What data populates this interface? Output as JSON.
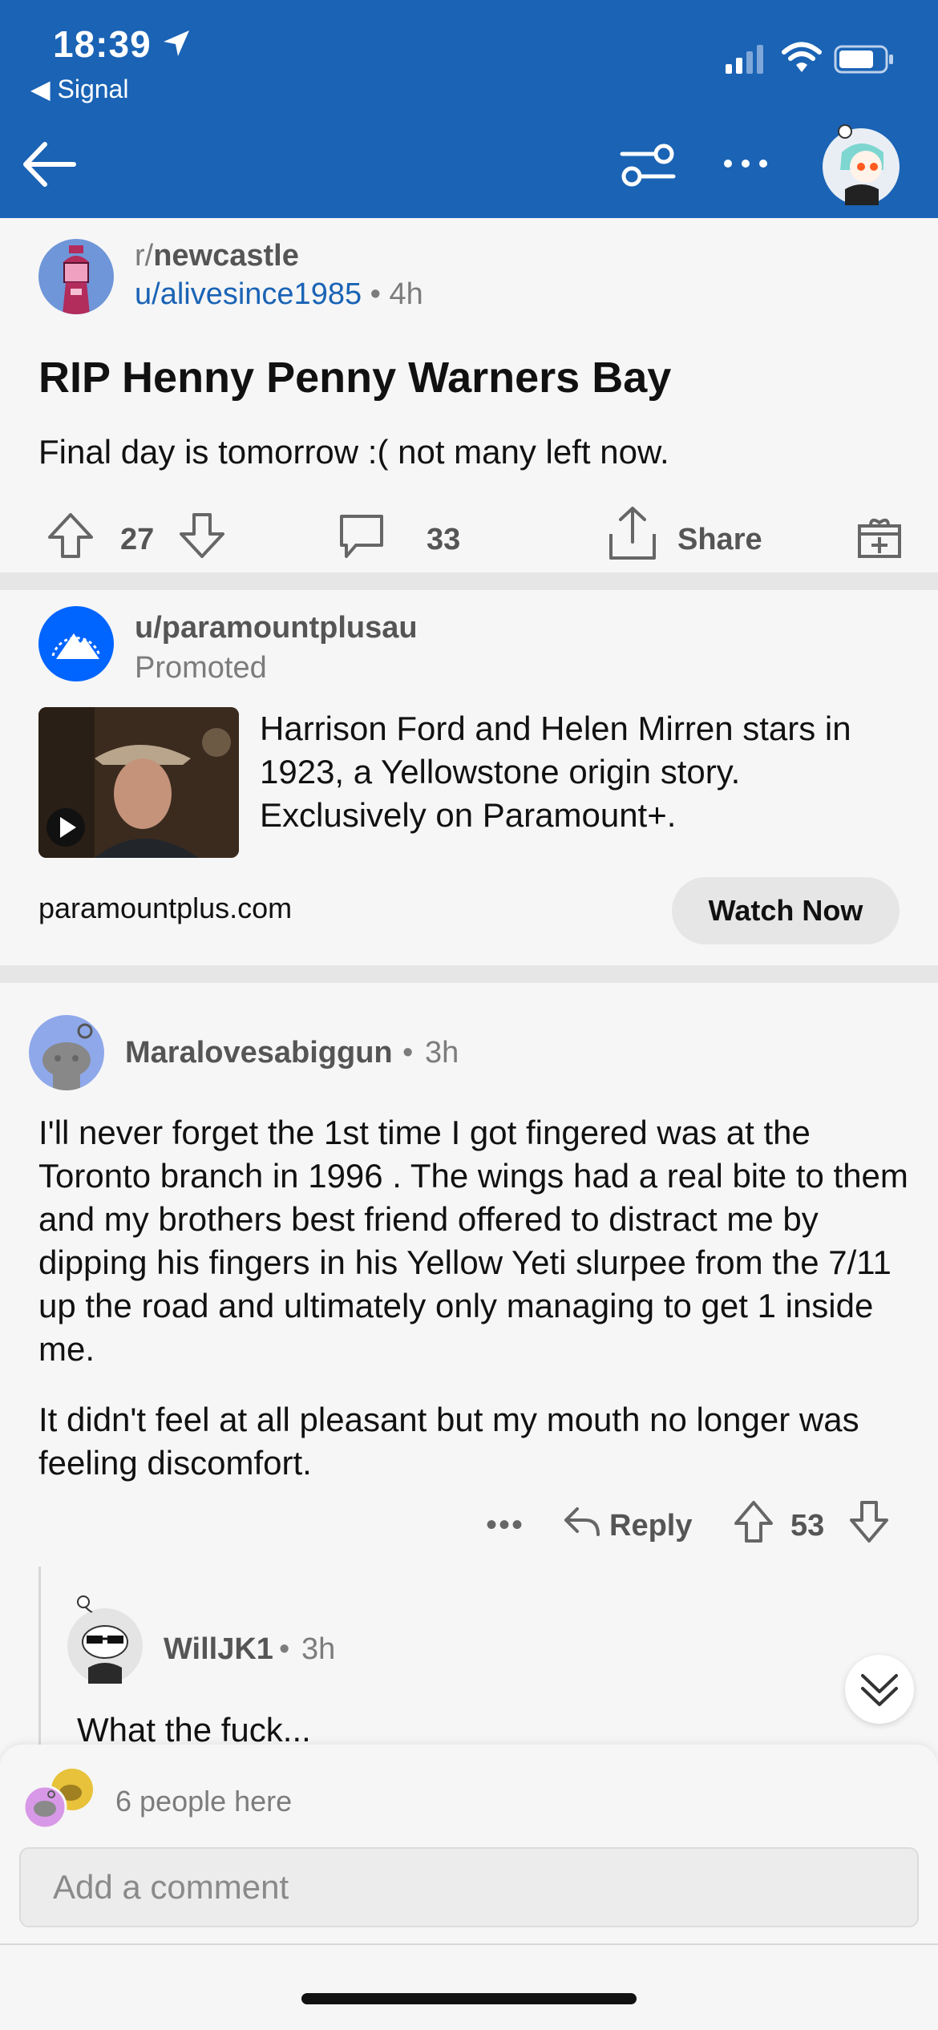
{
  "status_bar": {
    "time": "18:39",
    "back_app": "◀ Signal"
  },
  "colors": {
    "header_bg": "#1a63b5",
    "link_blue": "#1a63b5",
    "meta_gray": "#7c7c7c"
  },
  "icons": {
    "back": "back-arrow-icon",
    "filter": "sliders-icon",
    "more": "more-dots-icon",
    "profile": "avatar-icon",
    "upvote": "upvote-icon",
    "downvote": "downvote-icon",
    "comment": "comment-icon",
    "share": "share-icon",
    "gift": "gift-icon",
    "reply": "reply-icon",
    "play": "play-icon",
    "jump": "double-chevron-down-icon"
  },
  "post": {
    "subreddit_prefix": "r/",
    "subreddit": "newcastle",
    "author": "u/alivesince1985",
    "dot": "•",
    "time": "4h",
    "title": "RIP Henny Penny Warners Bay",
    "body": "Final day is tomorrow :( not many left now.",
    "votes": "27",
    "comments": "33",
    "share_label": "Share"
  },
  "promoted": {
    "user": "u/paramountplusau",
    "label": "Promoted",
    "text": "Harrison Ford and Helen Mirren stars in 1923, a Yellowstone origin story. Exclusively on Paramount+.",
    "domain": "paramountplus.com",
    "cta": "Watch Now"
  },
  "comment": {
    "author": "Maralovesabiggun",
    "dot": "•",
    "time": "3h",
    "body_p1": "I'll never forget the 1st time I got fingered was at the Toronto branch in 1996 . The wings had a real bite to them and my brothers best friend offered to distract me by dipping his fingers in his Yellow Yeti slurpee from the 7/11 up the road and ultimately only managing to get 1 inside me.",
    "body_p2": "It didn't feel at all pleasant but my mouth no longer was feeling discomfort.",
    "more": "•••",
    "reply_label": "Reply",
    "votes": "53"
  },
  "reply": {
    "author": "WillJK1",
    "dot": "•",
    "time": "3h",
    "body": "What the fuck..."
  },
  "composer": {
    "people_here": "6 people here",
    "placeholder": "Add a comment"
  }
}
